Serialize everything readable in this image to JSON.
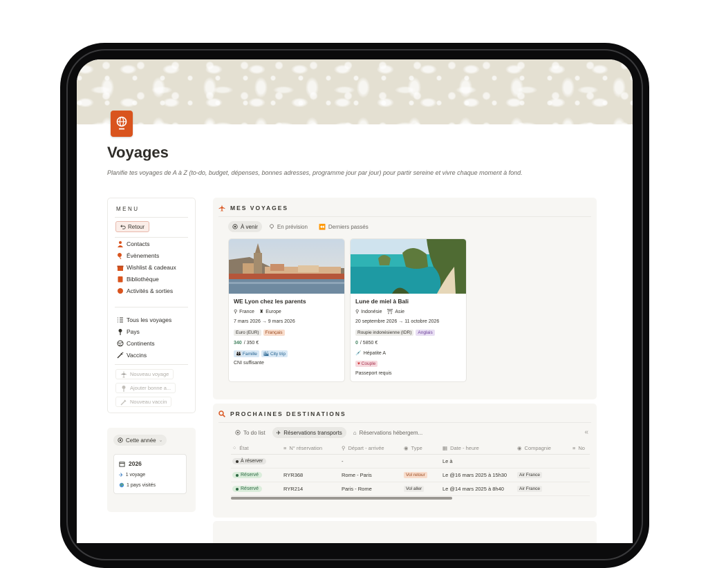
{
  "page": {
    "title": "Voyages",
    "description": "Planifie tes voyages de A à Z (to-do, budget, dépenses, bonnes adresses, programme jour par jour) pour partir sereine et vivre chaque moment à fond."
  },
  "colors": {
    "accent": "#d9541e",
    "panel_bg": "#f7f6f3",
    "green": "#448361"
  },
  "menu": {
    "title": "MENU",
    "back_label": "Retour",
    "items": [
      {
        "label": "Contacts",
        "icon": "contacts-icon"
      },
      {
        "label": "Évènements",
        "icon": "events-icon"
      },
      {
        "label": "Wishlist & cadeaux",
        "icon": "gift-icon"
      },
      {
        "label": "Bibliothèque",
        "icon": "book-icon"
      },
      {
        "label": "Activités & sorties",
        "icon": "activities-icon"
      }
    ],
    "items2": [
      {
        "label": "Tous les voyages",
        "icon": "list-icon"
      },
      {
        "label": "Pays",
        "icon": "pin-icon"
      },
      {
        "label": "Continents",
        "icon": "globe-icon"
      },
      {
        "label": "Vaccins",
        "icon": "syringe-icon"
      }
    ],
    "actions": [
      {
        "label": "Nouveau voyage",
        "icon": "plane-icon"
      },
      {
        "label": "Ajouter bonne a...",
        "icon": "pin-icon"
      },
      {
        "label": "Nouveau vaccin",
        "icon": "syringe-icon"
      }
    ]
  },
  "year": {
    "filter_label": "Cette année",
    "card_title": "2026",
    "line1": "1 voyage",
    "line2": "1 pays visités"
  },
  "voyages": {
    "title": "MES VOYAGES",
    "tabs": [
      "À venir",
      "En prévision",
      "Derniers passés"
    ],
    "cards": [
      {
        "name": "WE Lyon chez les parents",
        "country": "France",
        "continent": "Europe",
        "dates": "7 mars 2026 → 9 mars 2026",
        "currency": "Euro (EUR)",
        "language": "Français",
        "spent": "340",
        "budget": "/ 350 €",
        "tags": [
          "Famille",
          "City trip"
        ],
        "note": "CNI suffisante"
      },
      {
        "name": "Lune de miel à Bali",
        "country": "Indonésie",
        "continent": "Asie",
        "dates": "20 septembre 2026 → 11 octobre 2026",
        "currency": "Roupie indonésienne (IDR)",
        "language": "Anglais",
        "spent": "0",
        "budget": "/ 5850 €",
        "vaccine": "Hépatite A",
        "tags": [
          "Couple"
        ],
        "note": "Passeport requis"
      }
    ]
  },
  "destinations": {
    "title": "PROCHAINES DESTINATIONS",
    "tabs": [
      "To do list",
      "Réservations transports",
      "Réservations hébergem..."
    ],
    "collapse": "«",
    "columns": [
      "État",
      "N° réservation",
      "Départ - arrivée",
      "Type",
      "Date - heure",
      "Compagnie",
      "No"
    ],
    "rows": [
      {
        "state": "À réserver",
        "ref": "",
        "route": "-",
        "type": "",
        "date": "Le  à",
        "company": ""
      },
      {
        "state": "Réservé",
        "ref": "RYR368",
        "route": "Rome - Paris",
        "type": "Vol retour",
        "date": "Le @16 mars 2025 à 15h30",
        "company": "Air France"
      },
      {
        "state": "Réservé",
        "ref": "RYR214",
        "route": "Paris  - Rome",
        "type": "Vol aller",
        "date": "Le @14 mars 2025 à 8h40",
        "company": "Air France"
      }
    ]
  }
}
